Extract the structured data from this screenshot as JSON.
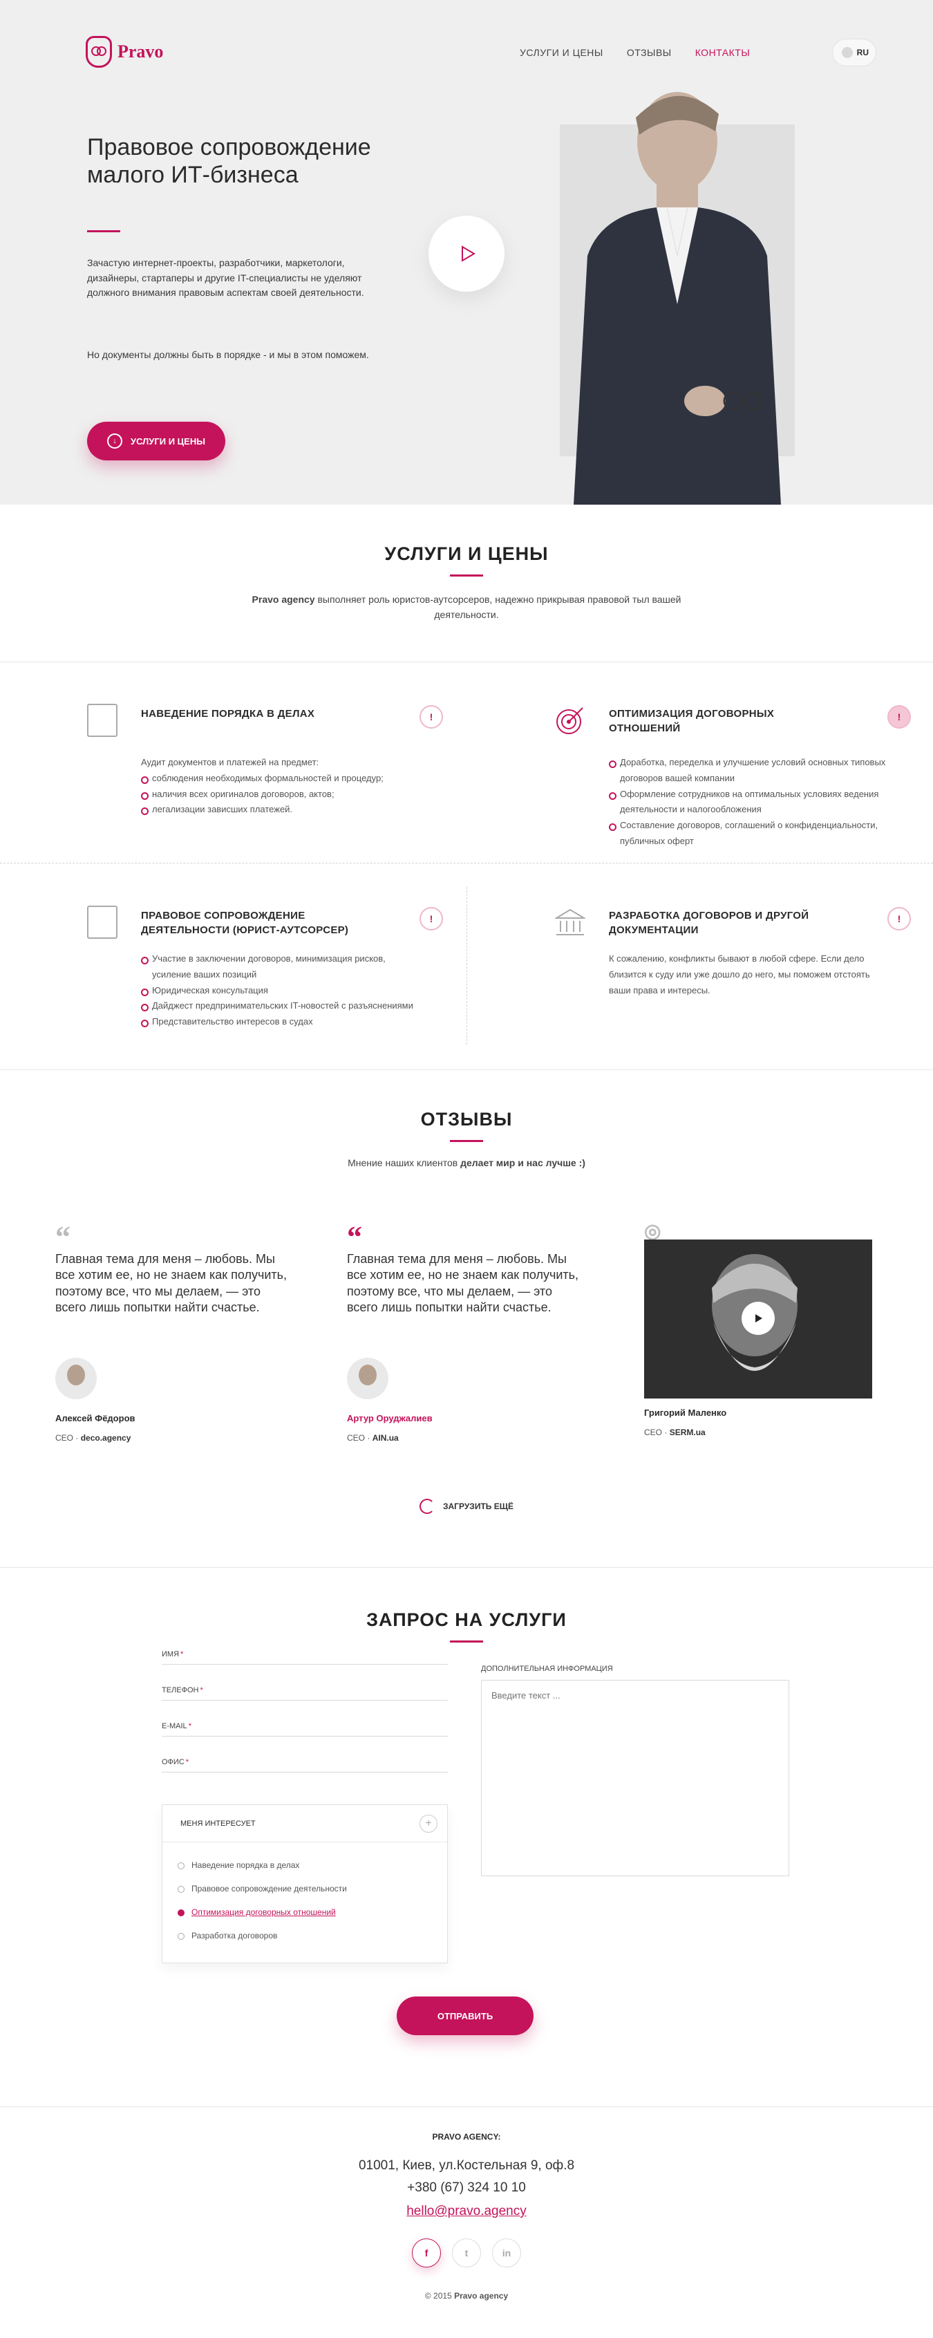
{
  "nav": {
    "logo": "Pravo",
    "menu": [
      "Услуги и цены",
      "Отзывы",
      "Контакты"
    ],
    "lang": "RU"
  },
  "hero": {
    "title": "Правовое сопровождение малого ИТ-бизнеса",
    "text1": "Зачастую интернет-проекты, разработчики, маркетологи, дизайнеры, стартаперы и другие IT-специалисты не уделяют должного внимания правовым аспектам своей деятельности.",
    "text2": "Но документы должны быть в порядке - и мы в этом поможем.",
    "button": "Услуги и цены"
  },
  "services": {
    "title": "Услуги и цены",
    "subtitle_brand": "Pravo agency",
    "subtitle": " выполняет роль юристов-аутсорсеров, надежно прикрывая правовой тыл вашей деятельности.",
    "items": [
      {
        "title": "Наведение порядка в делах",
        "intro": "Аудит документов и платежей на предмет:",
        "bullets": [
          "соблюдения необходимых формальностей и процедур;",
          "наличия всех оригиналов договоров, актов;",
          "легализации зависших платежей."
        ]
      },
      {
        "title": "Оптимизация договорных отношений",
        "bullets": [
          "Доработка, переделка и улучшение условий основных типовых договоров вашей компании",
          "Оформление сотрудников на оптимальных условиях ведения деятельности и налогообложения",
          "Составление договоров, соглашений о конфиденциальности, публичных оферт"
        ]
      },
      {
        "title": "Правовое сопровождение деятельности (юрист-аутсорсер)",
        "bullets": [
          "Участие в заключении договоров, минимизация рисков, усиление ваших позиций",
          "Юридическая консультация",
          "Дайджест предпринимательских IT-новостей с разъяснениями",
          "Представительство интересов в судах"
        ]
      },
      {
        "title": "Разработка договоров и другой документации",
        "text": "К сожалению, конфликты бывают в любой сфере. Если дело близится к суду или уже дошло до него, мы поможем отстоять ваши права и интересы."
      }
    ]
  },
  "reviews": {
    "title": "Отзывы",
    "subtitle_a": "Мнение наших клиентов ",
    "subtitle_b": "делает мир и нас лучше :)",
    "items": [
      {
        "text": "Главная тема для меня – любовь. Мы все хотим ее, но не знаем как получить, поэтому все, что мы делаем, — это всего лишь попытки найти счастье.",
        "name": "Алексей Фёдоров",
        "pos": "CEO",
        "company": "deco.agency"
      },
      {
        "text": "Главная тема для меня – любовь. Мы все хотим ее, но не знаем как получить, поэтому все, что мы делаем, — это всего лишь попытки найти счастье.",
        "name": "Артур Оруджалиев",
        "pos": "CEO",
        "company": "AIN.ua"
      },
      {
        "name": "Григорий Маленко",
        "pos": "CEO",
        "company": "SERM.ua"
      }
    ],
    "load_more": "Загрузить ещё"
  },
  "request": {
    "title": "Запрос на услуги",
    "fields": [
      "Имя",
      "Телефон",
      "E-mail",
      "Офис"
    ],
    "add_info": "Дополнительная информация",
    "placeholder": "Введите текст ...",
    "interests_title": "Меня интересует",
    "interests": [
      "Наведение порядка в делах",
      "Правовое сопровождение деятельности",
      "Оптимизация договорных отношений",
      "Разработка договоров"
    ],
    "submit": "Отправить"
  },
  "footer": {
    "title": "Pravo agency:",
    "address": "01001, Киев, ул.Костельная 9, оф.8",
    "phone": "+380 (67) 324 10 10",
    "email": "hello@pravo.agency",
    "copy_a": "© 2015 ",
    "copy_b": "Pravo agency"
  },
  "colors": {
    "accent": "#c4135a",
    "hero_bg": "#efefef"
  }
}
